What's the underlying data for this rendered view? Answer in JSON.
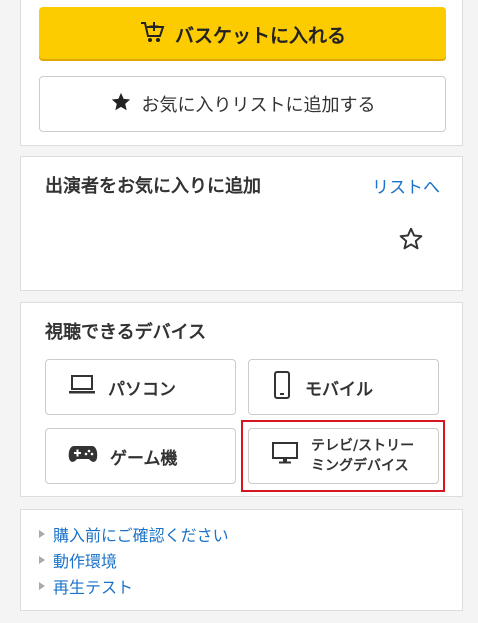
{
  "cart": {
    "add_to_basket_label": "バスケットに入れる",
    "add_to_favorites_label": "お気に入りリストに追加する"
  },
  "cast": {
    "title": "出演者をお気に入りに追加",
    "list_link": "リストへ"
  },
  "devices": {
    "title": "視聴できるデバイス",
    "pc": "パソコン",
    "mobile": "モバイル",
    "game": "ゲーム機",
    "tv_line1": "テレビ/ストリー",
    "tv_line2": "ミングデバイス"
  },
  "links": {
    "items": [
      "購入前にご確認ください",
      "動作環境",
      "再生テスト"
    ]
  },
  "colors": {
    "accent_yellow": "#fccb00",
    "link_blue": "#1a73c9",
    "highlight_red": "#d6161c"
  }
}
